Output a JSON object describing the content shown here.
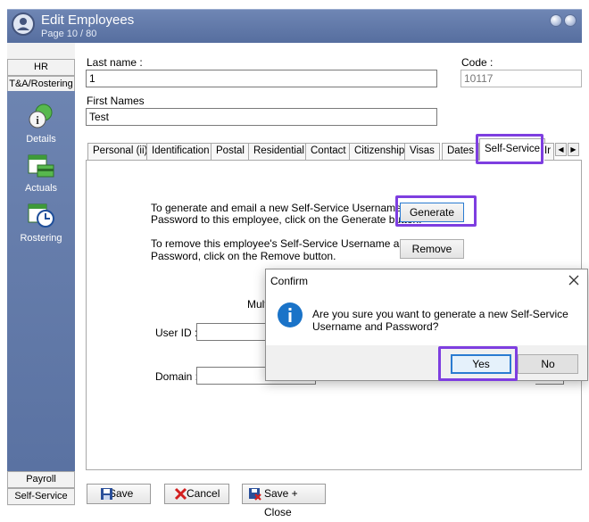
{
  "window": {
    "title": "Edit Employees",
    "page_info": "Page 10 / 80"
  },
  "sidebar": {
    "top_tabs": [
      "HR",
      "T&A/Rostering"
    ],
    "items": [
      {
        "label": "Details",
        "icon": "details-info-icon"
      },
      {
        "label": "Actuals",
        "icon": "actuals-calendar-icon"
      },
      {
        "label": "Rostering",
        "icon": "rostering-clock-icon"
      }
    ],
    "bottom_tabs": [
      "Payroll",
      "Self-Service"
    ]
  },
  "form": {
    "last_name_label": "Last name :",
    "last_name_value": "1",
    "first_names_label": "First Names",
    "first_names_value": "Test",
    "code_label": "Code :",
    "code_value": "10117"
  },
  "tabs": [
    "Personal (ii)",
    "Identification",
    "Postal",
    "Residential",
    "Contact",
    "Citizenship",
    "Visas",
    "Dates",
    "Self-Service",
    "Ir"
  ],
  "active_tab": "Self-Service",
  "self_service": {
    "generate_text_line1": "To generate and email a new Self-Service Username and",
    "generate_text_line2": "Password to this employee, click on the Generate button.",
    "generate_button": "Generate",
    "remove_text_line1": "To remove this employee's Self-Service Username and",
    "remove_text_line2": "Password, click on the Remove button.",
    "remove_button": "Remove",
    "partial_label": "Mult",
    "user_id_label": "User ID :",
    "domain_label": "Domain :"
  },
  "dialog": {
    "title": "Confirm",
    "message_line1": "Are you sure you want to generate a new Self-Service",
    "message_line2": "Username and Password?",
    "yes_button": "Yes",
    "no_button": "No"
  },
  "bottom_buttons": {
    "save": "Save",
    "cancel": "Cancel",
    "save_close": "Save + Close"
  },
  "colors": {
    "accent_highlight": "#7e3ee0",
    "title_bar": "#6f86b4",
    "info_icon": "#1a73c8"
  }
}
